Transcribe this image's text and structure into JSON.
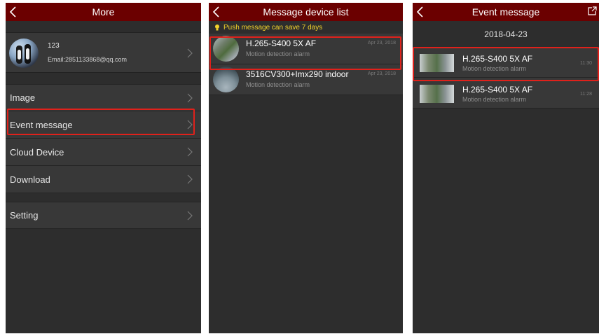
{
  "colors": {
    "topbar": "#6b0000",
    "panel_bg": "#2d2d2d",
    "row_bg": "#383838",
    "highlight": "#e0211b",
    "notice": "#f2d22b"
  },
  "more_screen": {
    "title": "More",
    "back_icon": "chevron-left-icon",
    "profile": {
      "name": "123",
      "email": "Email:2851133868@qq.com"
    },
    "menu": [
      {
        "label": "Image"
      },
      {
        "label": "Event message"
      },
      {
        "label": "Cloud Device"
      },
      {
        "label": "Download"
      },
      {
        "label": "Setting"
      }
    ]
  },
  "device_list_screen": {
    "title": "Message device list",
    "notice": "Push message can save 7 days",
    "devices": [
      {
        "name": "H.265-S400 5X AF",
        "subtitle": "Motion detection alarm",
        "date": "Apr 23, 2018"
      },
      {
        "name": "3516CV300+Imx290 indoor",
        "subtitle": "Motion detection alarm",
        "date": "Apr 23, 2018"
      }
    ]
  },
  "event_screen": {
    "title": "Event message",
    "share_icon": "share-icon",
    "date": "2018-04-23",
    "events": [
      {
        "name": "H.265-S400 5X AF",
        "subtitle": "Motion detection alarm",
        "time": "11:30"
      },
      {
        "name": "H.265-S400 5X AF",
        "subtitle": "Motion detection alarm",
        "time": "11:28"
      }
    ]
  }
}
